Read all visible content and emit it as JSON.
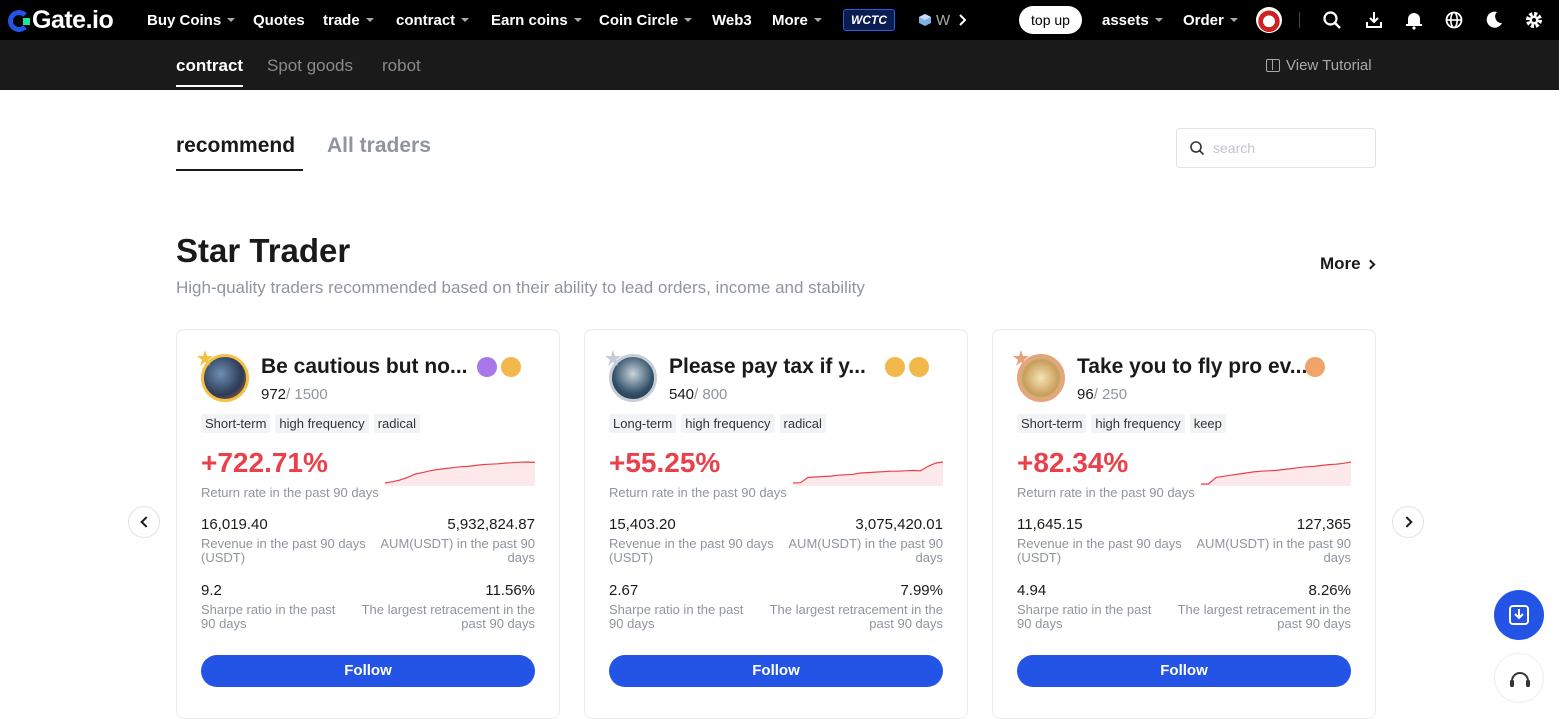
{
  "header": {
    "logo": "Gate.io",
    "nav": [
      {
        "label": "Buy Coins",
        "caret": true
      },
      {
        "label": "Quotes",
        "caret": false
      },
      {
        "label": "trade",
        "caret": true
      },
      {
        "label": "contract",
        "caret": true
      },
      {
        "label": "Earn coins",
        "caret": true
      },
      {
        "label": "Coin Circle",
        "caret": true
      },
      {
        "label": "Web3",
        "caret": false
      },
      {
        "label": "More",
        "caret": true
      }
    ],
    "wctc": "WCTC",
    "promo_truncated": "W",
    "top_up": "top up",
    "assets": "assets",
    "order": "Order",
    "icons": [
      "search-icon",
      "download-icon",
      "bell-icon",
      "globe-icon",
      "moon-icon",
      "gear-icon"
    ]
  },
  "subnav": {
    "tabs": [
      "contract",
      "Spot goods",
      "robot"
    ],
    "active": "contract",
    "tutorial": "View Tutorial"
  },
  "main": {
    "tabs": [
      "recommend",
      "All traders"
    ],
    "active_tab": "recommend",
    "search_placeholder": "search",
    "section_title": "Star Trader",
    "section_subtitle": "High-quality traders recommended based on their ability to lead orders, income and stability",
    "more": "More"
  },
  "cards": [
    {
      "name": "Be cautious but no...",
      "followers": "972",
      "max": "/ 1500",
      "tags": [
        "Short-term",
        "high frequency",
        "radical"
      ],
      "return": "+722.71%",
      "return_label": "Return rate in the past 90 days",
      "revenue": "16,019.40",
      "revenue_label": "Revenue in the past 90 days (USDT)",
      "aum": "5,932,824.87",
      "aum_label": "AUM(USDT) in the past 90 days",
      "sharpe": "9.2",
      "sharpe_label": "Sharpe ratio in the past 90 days",
      "retrace": "11.56%",
      "retrace_label": "The largest retracement in the past 90 days",
      "follow": "Follow",
      "badges": [
        "#a678e8",
        "#f2b84b"
      ],
      "spark": [
        0.05,
        0.1,
        0.18,
        0.3,
        0.45,
        0.52,
        0.6,
        0.66,
        0.7,
        0.74,
        0.78,
        0.8,
        0.84,
        0.88,
        0.9,
        0.92,
        0.95,
        0.97,
        0.99,
        1.0,
        0.98
      ]
    },
    {
      "name": "Please pay tax if y...",
      "followers": "540",
      "max": "/ 800",
      "tags": [
        "Long-term",
        "high frequency",
        "radical"
      ],
      "return": "+55.25%",
      "return_label": "Return rate in the past 90 days",
      "revenue": "15,403.20",
      "revenue_label": "Revenue in the past 90 days (USDT)",
      "aum": "3,075,420.01",
      "aum_label": "AUM(USDT) in the past 90 days",
      "sharpe": "2.67",
      "sharpe_label": "Sharpe ratio in the past 90 days",
      "retrace": "7.99%",
      "retrace_label": "The largest retracement in the past 90 days",
      "follow": "Follow",
      "badges": [
        "#f2b84b",
        "#f2b84b"
      ],
      "spark": [
        0.05,
        0.06,
        0.3,
        0.32,
        0.34,
        0.36,
        0.4,
        0.42,
        0.44,
        0.5,
        0.52,
        0.54,
        0.56,
        0.58,
        0.58,
        0.6,
        0.62,
        0.6,
        0.8,
        0.95,
        1.0
      ]
    },
    {
      "name": "Take you to fly pro ev...",
      "followers": "96",
      "max": "/ 250",
      "tags": [
        "Short-term",
        "high frequency",
        "keep"
      ],
      "return": "+82.34%",
      "return_label": "Return rate in the past 90 days",
      "revenue": "11,645.15",
      "revenue_label": "Revenue in the past 90 days (USDT)",
      "aum": "127,365",
      "aum_label": "AUM(USDT) in the past 90 days",
      "sharpe": "4.94",
      "sharpe_label": "Sharpe ratio in the past 90 days",
      "retrace": "8.26%",
      "retrace_label": "The largest retracement in the past 90 days",
      "follow": "Follow",
      "badges": [
        "#f0a46a"
      ],
      "spark": [
        0.0,
        0.0,
        0.3,
        0.35,
        0.4,
        0.45,
        0.5,
        0.55,
        0.58,
        0.6,
        0.62,
        0.66,
        0.7,
        0.74,
        0.78,
        0.8,
        0.84,
        0.88,
        0.9,
        0.94,
        1.0
      ]
    }
  ]
}
